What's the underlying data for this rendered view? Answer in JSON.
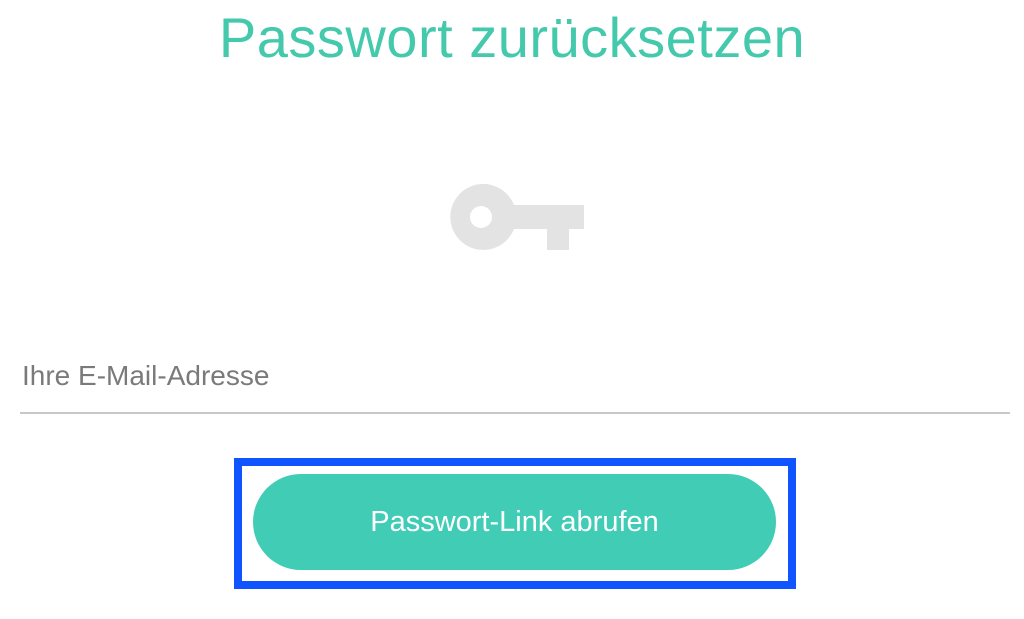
{
  "page": {
    "title": "Passwort zurücksetzen"
  },
  "icons": {
    "key": "key-icon"
  },
  "form": {
    "email_placeholder": "Ihre E-Mail-Adresse",
    "email_value": "",
    "submit_label": "Passwort-Link abrufen"
  },
  "colors": {
    "accent": "#45c9ac",
    "button": "#41ccb6",
    "icon": "#e3e3e3",
    "highlight": "#0f54ff",
    "input_text": "#7a7a7a",
    "underline": "#c8c8c8"
  }
}
